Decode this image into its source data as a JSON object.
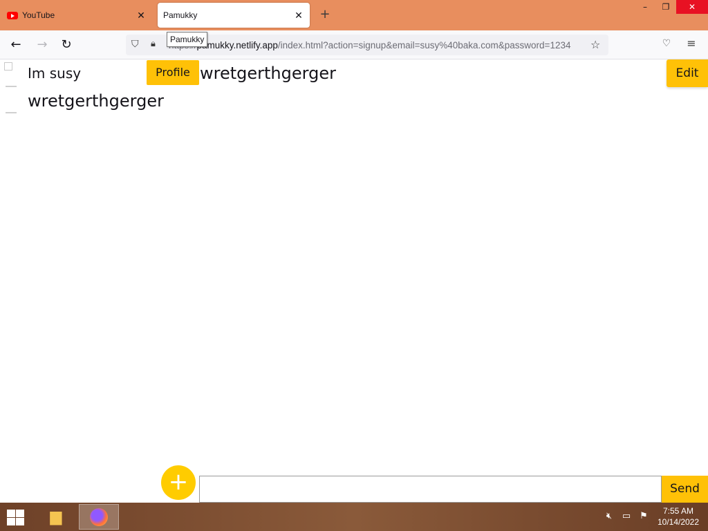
{
  "browser": {
    "tabs": [
      {
        "label": "YouTube",
        "icon": "youtube-icon"
      },
      {
        "label": "Pamukky",
        "icon": "none"
      }
    ],
    "tooltip": "Pamukky",
    "url": {
      "scheme": "https://",
      "domain": "pamukky.netlify.app",
      "rest": "/index.html?action=signup&email=susy%40baka.com&password=1234"
    }
  },
  "page": {
    "username": "Im susy",
    "profile_label": "Profile",
    "header_status": "wretgerthgerger",
    "edit_label": "Edit",
    "message": "wretgerthgerger",
    "add_label": "+",
    "input_value": "",
    "send_label": "Send",
    "accent_color": "#ffc107"
  },
  "taskbar": {
    "time": "7:55 AM",
    "date": "10/14/2022"
  }
}
